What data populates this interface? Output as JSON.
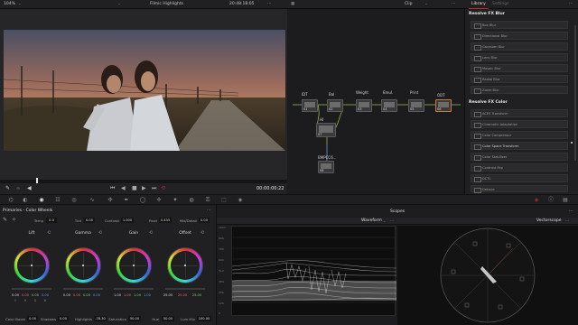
{
  "topbar": {
    "zoom": "104%",
    "project_title": "Filmic Highlights",
    "timecode": "20:48:18:05",
    "clip_label": "Clip",
    "library_label": "Library",
    "settings_label": "Settings"
  },
  "viewer": {
    "timecode": "00:00:00:22"
  },
  "nodes": [
    {
      "label": "IDT",
      "num": "01"
    },
    {
      "label": "Bal",
      "num": "02"
    },
    {
      "label": "Weight",
      "num": "03"
    },
    {
      "label": "Emul.",
      "num": "04"
    },
    {
      "label": "Print",
      "num": "05"
    },
    {
      "label": "ODT",
      "num": "06"
    },
    {
      "label": "HI",
      "num": "07"
    },
    {
      "label": "BMPCC6...",
      "num": "08"
    }
  ],
  "library": {
    "blur_section": "Resolve FX Blur",
    "blur_items": [
      "Box Blur",
      "Directional Blur",
      "Gaussian Blur",
      "Lens Blur",
      "Mosaic Blur",
      "Radial Blur",
      "Zoom Blur"
    ],
    "color_section": "Resolve FX Color",
    "color_items": [
      "ACES Transform",
      "Chromatic Adaptation",
      "Color Compressor",
      "Color Space Transform",
      "Color Stabilizer",
      "Contrast Pop",
      "DCTL",
      "Dehaze"
    ]
  },
  "primaries": {
    "title": "Primaries - Color Wheels",
    "temp_label": "Temp",
    "temp_value": "0.0",
    "tint_label": "Tint",
    "tint_value": "0.00",
    "contrast_label": "Contrast",
    "contrast_value": "1.000",
    "pivot_label": "Pivot",
    "pivot_value": "0.435",
    "middetail_label": "Mid/Detail",
    "middetail_value": "0.00",
    "wheels": [
      {
        "name": "Lift",
        "values": [
          "0.00",
          "0.00",
          "0.00",
          "0.00"
        ]
      },
      {
        "name": "Gamma",
        "values": [
          "0.00",
          "0.00",
          "0.00",
          "0.00"
        ]
      },
      {
        "name": "Gain",
        "values": [
          "1.00",
          "1.00",
          "1.00",
          "1.00"
        ]
      },
      {
        "name": "Offset",
        "values": [
          "25.00",
          "25.00",
          "25.00",
          "25.00"
        ]
      }
    ],
    "channel_labels": [
      "Y",
      "R",
      "G",
      "B"
    ],
    "bottom": {
      "colorboost_label": "Color Boost",
      "colorboost_value": "0.00",
      "shadows_label": "Shadows",
      "shadows_value": "0.00",
      "highlights_label": "Highlights",
      "highlights_value": "-78.30",
      "saturation_label": "Saturation",
      "saturation_value": "50.00",
      "hue_label": "Hue",
      "hue_value": "50.00",
      "lummix_label": "Lum Mix",
      "lummix_value": "100.00"
    }
  },
  "scopes": {
    "title": "Scopes",
    "waveform_label": "Waveform",
    "vectorscope_label": "Vectorscope",
    "wave_ticks": [
      "1023",
      "896",
      "768",
      "640",
      "512",
      "384",
      "256",
      "128",
      "0"
    ]
  },
  "colors": {
    "accent_red": "#c4262e",
    "panel": "#202022"
  }
}
